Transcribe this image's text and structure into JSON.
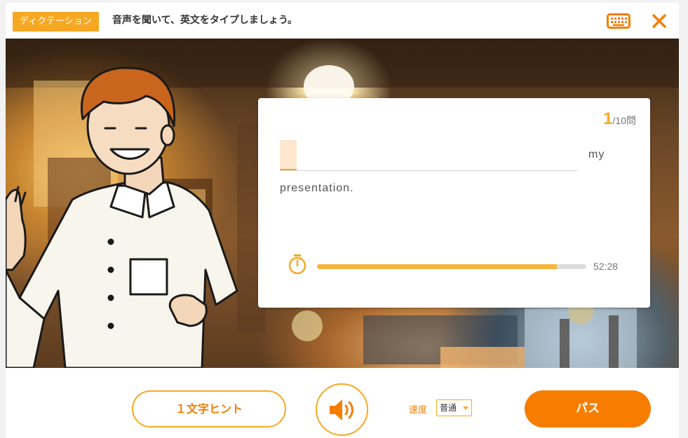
{
  "header": {
    "mode_tag": "ディクテーション",
    "instruction": "音声を聞いて、英文をタイプしましょう。",
    "keyboard_icon": "keyboard-icon",
    "close_icon": "close-icon"
  },
  "question": {
    "current": "1",
    "total_suffix": "/10問",
    "blank_input_value": "",
    "word_after_blank": "my",
    "line2_text": "presentation."
  },
  "timer": {
    "icon": "stopwatch-icon",
    "progress_fraction": 0.89,
    "time_text": "52:28"
  },
  "controls": {
    "hint_label": "１文字ヒント",
    "sound_icon": "speaker-icon",
    "speed_label": "速度",
    "speed_value": "普通",
    "pass_label": "パス"
  },
  "colors": {
    "accent": "#f7a823",
    "accent_dark": "#f77d00",
    "text": "#333333"
  }
}
